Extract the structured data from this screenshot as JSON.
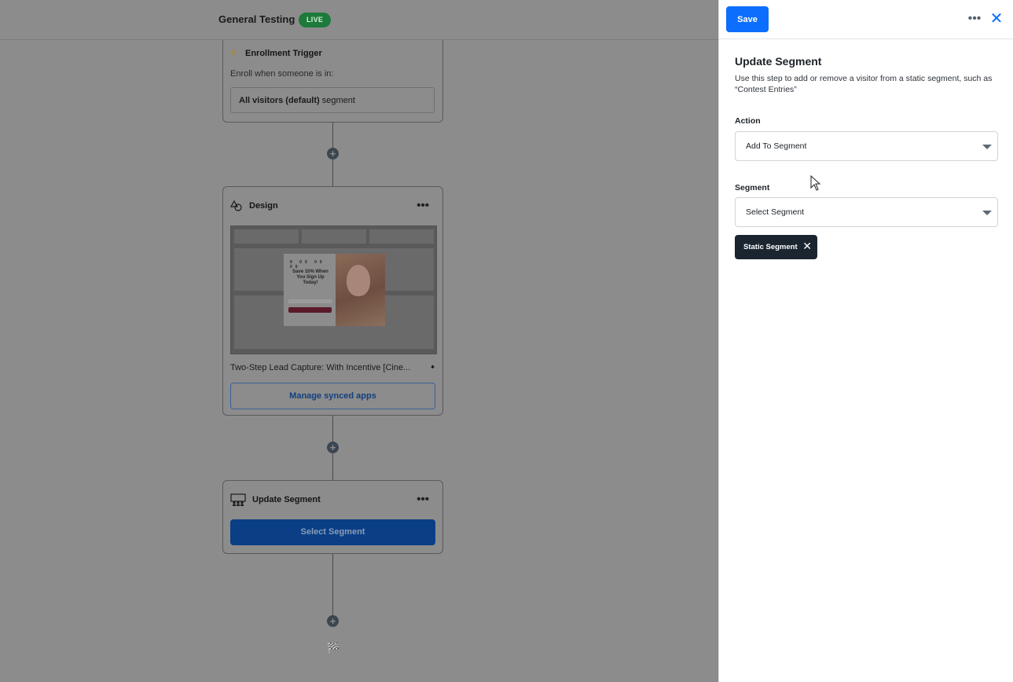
{
  "header": {
    "title": "General Testing",
    "status_badge": "LIVE"
  },
  "canvas": {
    "enrollment": {
      "title": "Enrollment Trigger",
      "subtitle": "Enroll when someone is in:",
      "segment_bold": "All visitors (default)",
      "segment_suffix": " segment"
    },
    "design": {
      "title": "Design",
      "more": "•••",
      "caption": "Two-Step Lead Capture: With Incentive [Cine...",
      "popup_headline": "Save 10% When You Sign Up Today!",
      "manage_button": "Manage synced apps"
    },
    "update_segment": {
      "title": "Update Segment",
      "more": "•••",
      "select_button": "Select Segment"
    }
  },
  "panel": {
    "save_label": "Save",
    "title": "Update Segment",
    "description": "Use this step to add or remove a visitor from a static segment, such as “Contest Entries”",
    "action": {
      "label": "Action",
      "value": "Add To Segment"
    },
    "segment": {
      "label": "Segment",
      "value": "Select Segment"
    },
    "tag": {
      "label": "Static Segment"
    }
  }
}
